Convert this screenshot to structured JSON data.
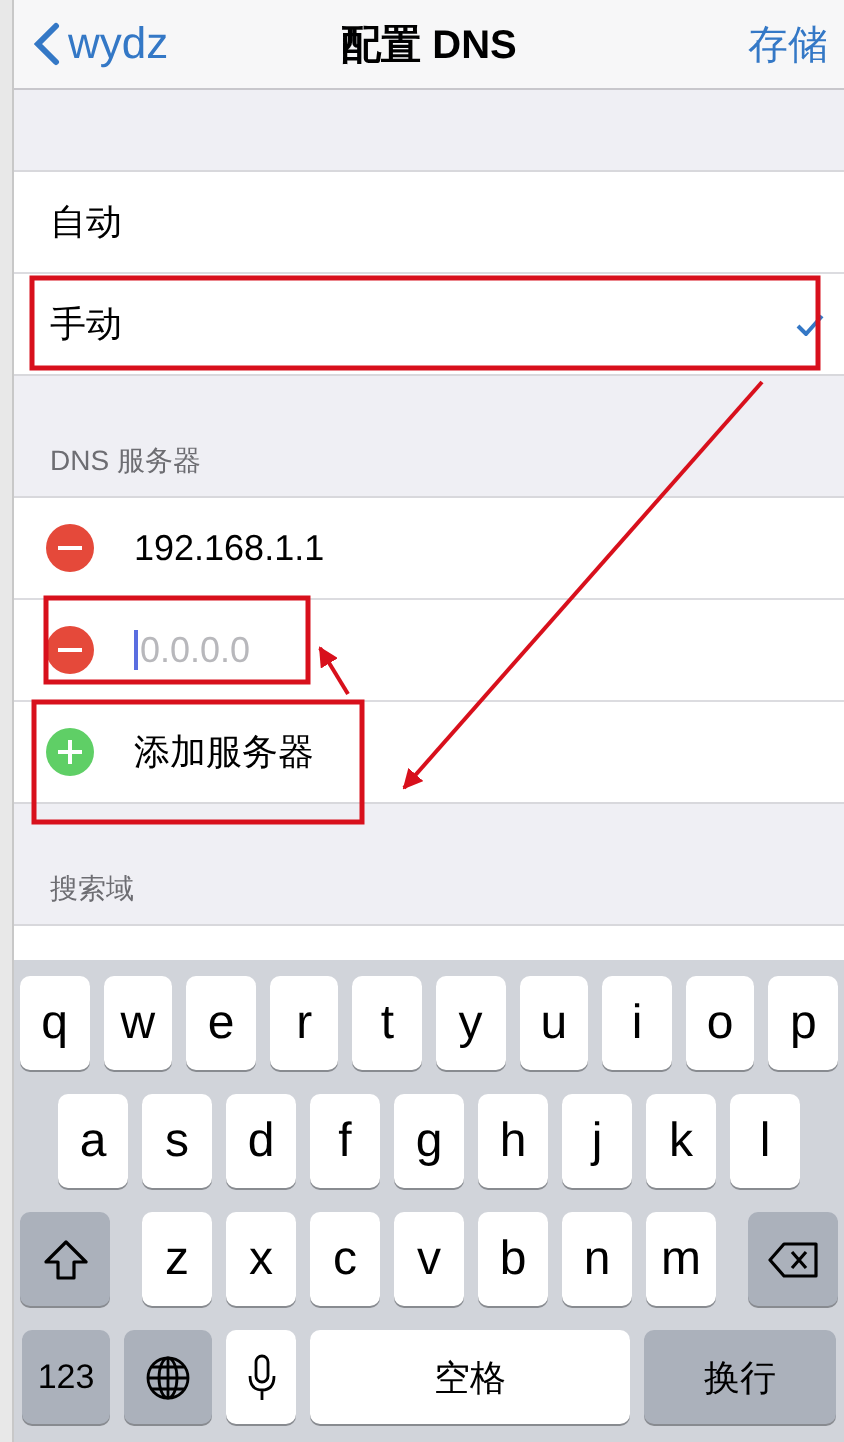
{
  "nav": {
    "back": "wydz",
    "title": "配置 DNS",
    "action": "存储"
  },
  "mode_options": [
    {
      "label": "自动",
      "selected": false
    },
    {
      "label": "手动",
      "selected": true
    }
  ],
  "dns_section": {
    "header": "DNS 服务器",
    "servers": [
      {
        "kind": "entry",
        "value": "192.168.1.1"
      },
      {
        "kind": "entry",
        "placeholder": "0.0.0.0",
        "focused": true
      },
      {
        "kind": "add",
        "label": "添加服务器"
      }
    ]
  },
  "search_domains": {
    "header": "搜索域"
  },
  "keyboard": {
    "top_row": [
      {
        "kind": "letter",
        "label": "q"
      },
      {
        "kind": "letter",
        "label": "w"
      },
      {
        "kind": "letter",
        "label": "e"
      },
      {
        "kind": "letter",
        "label": "r"
      },
      {
        "kind": "letter",
        "label": "t"
      },
      {
        "kind": "letter",
        "label": "y"
      },
      {
        "kind": "letter",
        "label": "u"
      },
      {
        "kind": "letter",
        "label": "i"
      },
      {
        "kind": "letter",
        "label": "o"
      },
      {
        "kind": "letter",
        "label": "p"
      }
    ],
    "home_row": [
      {
        "kind": "letter",
        "label": "a"
      },
      {
        "kind": "letter",
        "label": "s"
      },
      {
        "kind": "letter",
        "label": "d"
      },
      {
        "kind": "letter",
        "label": "f"
      },
      {
        "kind": "letter",
        "label": "g"
      },
      {
        "kind": "letter",
        "label": "h"
      },
      {
        "kind": "letter",
        "label": "j"
      },
      {
        "kind": "letter",
        "label": "k"
      },
      {
        "kind": "letter",
        "label": "l"
      }
    ],
    "bottom_row": [
      {
        "kind": "shift"
      },
      {
        "kind": "letter",
        "label": "z"
      },
      {
        "kind": "letter",
        "label": "x"
      },
      {
        "kind": "letter",
        "label": "c"
      },
      {
        "kind": "letter",
        "label": "v"
      },
      {
        "kind": "letter",
        "label": "b"
      },
      {
        "kind": "letter",
        "label": "n"
      },
      {
        "kind": "letter",
        "label": "m"
      },
      {
        "kind": "delete"
      }
    ],
    "function_row": [
      {
        "kind": "numbers",
        "label": "123"
      },
      {
        "kind": "globe"
      },
      {
        "kind": "mic"
      },
      {
        "kind": "space",
        "label": "空格"
      },
      {
        "kind": "return",
        "label": "换行"
      }
    ]
  }
}
